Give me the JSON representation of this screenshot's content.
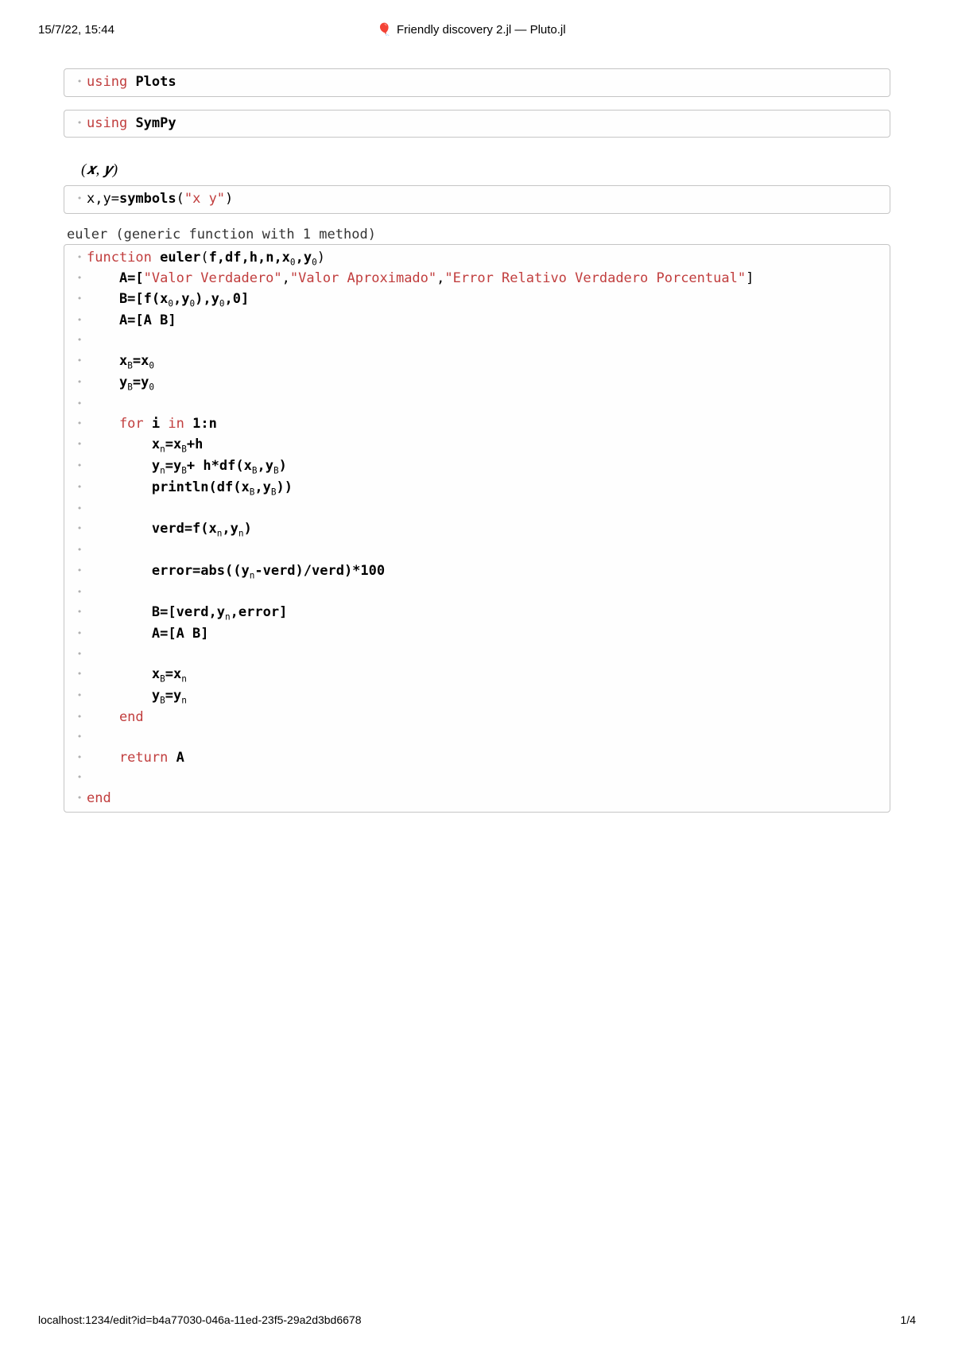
{
  "header": {
    "timestamp": "15/7/22, 15:44",
    "title": "Friendly discovery 2.jl — Pluto.jl"
  },
  "cells": {
    "plots": {
      "kw": "using",
      "pkg": "Plots"
    },
    "sympy": {
      "kw": "using",
      "pkg": "SymPy"
    },
    "symbols_output": "(𝒙, 𝒚)",
    "symbols_line": {
      "lhs": "x,y=",
      "fn": "symbols",
      "open": "(",
      "arg": "\"x y\"",
      "close": ")"
    },
    "euler_output": "euler (generic function with 1 method)",
    "euler": {
      "l01_kw": "function",
      "l01_name": " euler",
      "l01_args_open": "(",
      "l01_args": "f,df,h,n,x",
      "l01_sub0a": "0",
      "l01_comma": ",y",
      "l01_sub0b": "0",
      "l01_close": ")",
      "l02_pre": "    A=[",
      "l02_s1": "\"Valor Verdadero\"",
      "l02_c1": ",",
      "l02_s2": "\"Valor Aproximado\"",
      "l02_c2": ",",
      "l02_s3": "\"Error Relativo Verdadero Porcentual\"",
      "l02_close": "]",
      "l03": "    B=[f(x",
      "l03_s0a": "0",
      "l03_mid": ",y",
      "l03_s0b": "0",
      "l03_mid2": "),y",
      "l03_s0c": "0",
      "l03_end": ",0]",
      "l04": "    A=[A B]",
      "l06a": "    x",
      "l06sB": "B",
      "l06mid": "=x",
      "l06s0": "0",
      "l07a": "    y",
      "l07sB": "B",
      "l07mid": "=y",
      "l07s0": "0",
      "l09_kw": "    for",
      "l09_rest": " i ",
      "l09_in": "in",
      "l09_range": " 1:n",
      "l10a": "        x",
      "l10sn": "n",
      "l10mid": "=x",
      "l10sB": "B",
      "l10end": "+h",
      "l11a": "        y",
      "l11sn": "n",
      "l11mid": "=y",
      "l11sB": "B",
      "l11mid2": "+ h*df(x",
      "l11sB2": "B",
      "l11mid3": ",y",
      "l11sB3": "B",
      "l11end": ")",
      "l12a": "        println(df(x",
      "l12sB": "B",
      "l12mid": ",y",
      "l12sB2": "B",
      "l12end": "))",
      "l14a": "        verd=f(x",
      "l14sn": "n",
      "l14mid": ",y",
      "l14sn2": "n",
      "l14end": ")",
      "l16a": "        error=abs((y",
      "l16sn": "n",
      "l16end": "-verd)/verd)*100",
      "l18a": "        B=[verd,y",
      "l18sn": "n",
      "l18end": ",error]",
      "l19": "        A=[A B]",
      "l21a": "        x",
      "l21sB": "B",
      "l21mid": "=x",
      "l21sn": "n",
      "l22a": "        y",
      "l22sB": "B",
      "l22mid": "=y",
      "l22sn": "n",
      "l23": "    end",
      "l25_kw": "    return",
      "l25_rest": " A",
      "l27": "end"
    }
  },
  "footer": {
    "url": "localhost:1234/edit?id=b4a77030-046a-11ed-23f5-29a2d3bd6678",
    "page": "1/4"
  }
}
